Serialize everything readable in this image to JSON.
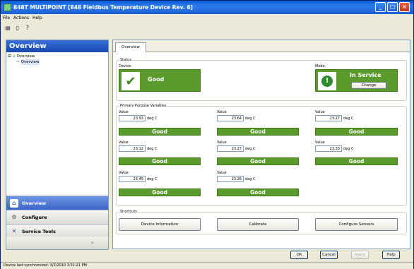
{
  "window": {
    "title": "848T MULTIPOINT [848 Fieldbus Temperature Device Rev. 6]"
  },
  "menu": [
    "File",
    "Actions",
    "Help"
  ],
  "left_panel": {
    "header": "Overview",
    "tree": [
      {
        "label": "Overview",
        "level": 0
      },
      {
        "label": "Overview",
        "level": 1
      }
    ],
    "nav": [
      {
        "label": "Overview",
        "icon": "home-icon",
        "active": true
      },
      {
        "label": "Configure",
        "icon": "configure-icon",
        "active": false
      },
      {
        "label": "Service Tools",
        "icon": "tools-icon",
        "active": false
      }
    ]
  },
  "content": {
    "tab": "Overview",
    "status": {
      "group_label": "Status",
      "device_label": "Device:",
      "device_value": "Good",
      "mode_label": "Mode:",
      "mode_value": "In Service",
      "change_button": "Change"
    },
    "pv": {
      "group_label": "Primary Purpose Variables",
      "items": [
        {
          "label": "Value",
          "value": "23.93",
          "unit": "deg C",
          "status": "Good"
        },
        {
          "label": "Value",
          "value": "23.64",
          "unit": "deg C",
          "status": "Good"
        },
        {
          "label": "Value",
          "value": "23.27",
          "unit": "deg C",
          "status": "Good"
        },
        {
          "label": "Value",
          "value": "23.12",
          "unit": "deg C",
          "status": "Good"
        },
        {
          "label": "Value",
          "value": "23.27",
          "unit": "deg C",
          "status": "Good"
        },
        {
          "label": "Value",
          "value": "23.33",
          "unit": "deg C",
          "status": "Good"
        },
        {
          "label": "Value",
          "value": "23.49",
          "unit": "deg C",
          "status": "Good"
        },
        {
          "label": "Value",
          "value": "23.26",
          "unit": "deg C",
          "status": "Good"
        }
      ]
    },
    "shortcuts": {
      "group_label": "Shortcuts",
      "buttons": [
        "Device Information",
        "Calibrate",
        "Configure Sensors"
      ]
    }
  },
  "dialog_buttons": {
    "ok": "OK",
    "cancel": "Cancel",
    "apply": "Apply",
    "help": "Help"
  },
  "statusbar": "Device last synchronized: 3/2/2010 3:51:21 PM",
  "colors": {
    "good": "#5b9a2c",
    "title": "#0A5BD8"
  }
}
